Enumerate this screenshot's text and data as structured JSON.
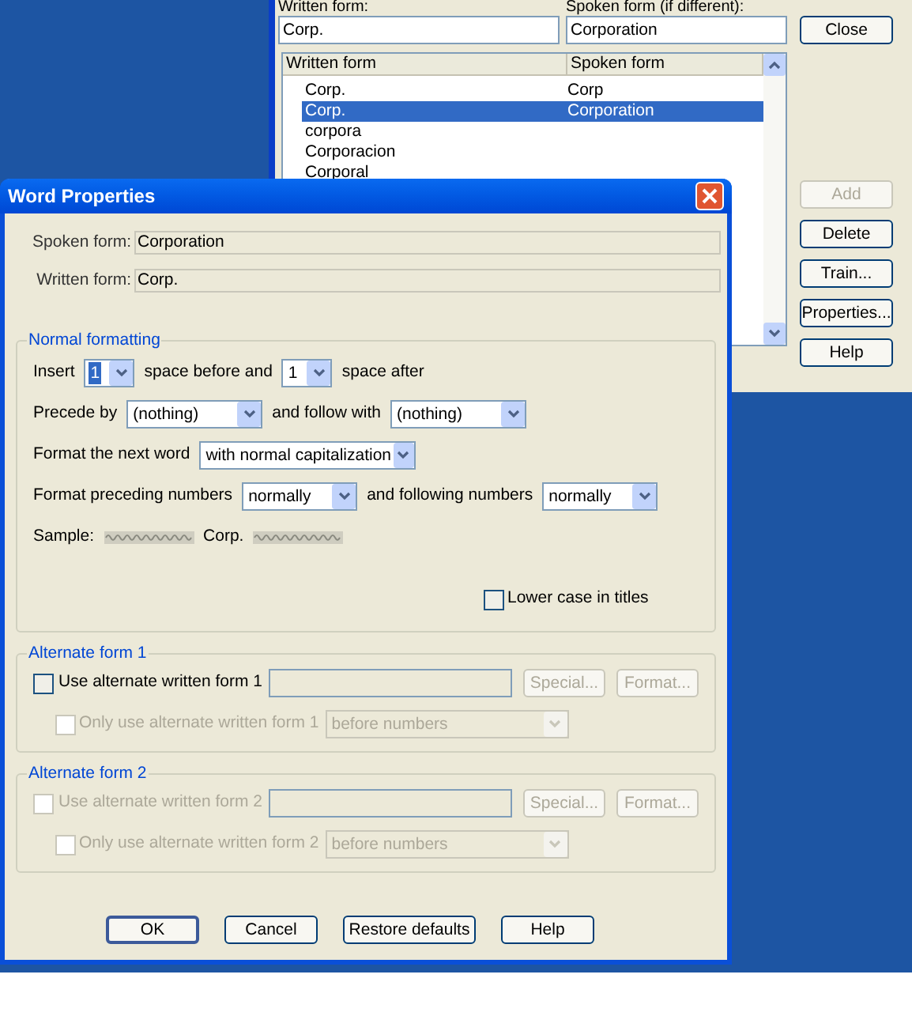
{
  "back_window": {
    "written_label": "Written form:",
    "spoken_label": "Spoken form (if different):",
    "written_value": "Corp.",
    "spoken_value": "Corporation",
    "list": {
      "columns": [
        "Written form",
        "Spoken form"
      ],
      "rows": [
        {
          "written": "Corp.",
          "spoken": "Corp",
          "selected": false
        },
        {
          "written": "Corp.",
          "spoken": "Corporation",
          "selected": true
        },
        {
          "written": "corpora",
          "selected": false
        },
        {
          "written": "Corporacion",
          "selected": false
        },
        {
          "written": "Corporal",
          "selected": false
        }
      ]
    },
    "close_button": "Close",
    "buttons": [
      {
        "label": "Add",
        "disabled": true
      },
      {
        "label": "Delete",
        "disabled": false
      },
      {
        "label": "Train...",
        "disabled": false
      },
      {
        "label": "Properties...",
        "disabled": false
      },
      {
        "label": "Help",
        "disabled": false
      }
    ]
  },
  "dialog": {
    "title": "Word Properties",
    "fields": [
      {
        "label": "Spoken form:",
        "value": "Corporation"
      },
      {
        "label": "Written form:",
        "value": "Corp."
      }
    ],
    "normal_formatting": {
      "title": "Normal formatting",
      "rows": [
        {
          "parts": [
            {
              "kind": "label",
              "text": "Insert"
            },
            {
              "kind": "dropdown",
              "value": "1",
              "highlighted": true
            },
            {
              "kind": "label",
              "text": "space before and"
            },
            {
              "kind": "dropdown",
              "value": "1",
              "highlighted": false
            },
            {
              "kind": "label",
              "text": "space after"
            }
          ]
        },
        {
          "parts": [
            {
              "kind": "label",
              "text": "Precede by"
            },
            {
              "kind": "dropdown",
              "value": "(nothing)",
              "highlighted": false
            },
            {
              "kind": "label",
              "text": "and follow with"
            },
            {
              "kind": "dropdown",
              "value": "(nothing)",
              "highlighted": false
            }
          ]
        },
        {
          "parts": [
            {
              "kind": "label",
              "text": "Format the next word"
            },
            {
              "kind": "dropdown",
              "value": "with normal capitalization",
              "highlighted": false
            }
          ]
        },
        {
          "parts": [
            {
              "kind": "label",
              "text": "Format preceding numbers"
            },
            {
              "kind": "dropdown",
              "value": "normally",
              "highlighted": false
            },
            {
              "kind": "label",
              "text": "and following numbers"
            },
            {
              "kind": "dropdown",
              "value": "normally",
              "highlighted": false
            }
          ]
        },
        {
          "parts": [
            {
              "kind": "label",
              "text": "Sample:"
            },
            {
              "kind": "squiggle"
            },
            {
              "kind": "label",
              "text": "Corp."
            },
            {
              "kind": "squiggle"
            }
          ]
        }
      ],
      "lower_case": {
        "label": "Lower case in titles",
        "checked": false
      }
    },
    "alternates": [
      {
        "title": "Alternate form 1",
        "use": {
          "label": "Use alternate written form 1",
          "checked": false,
          "disabled": false
        },
        "buttons": [
          {
            "label": "Special...",
            "disabled": true
          },
          {
            "label": "Format...",
            "disabled": true
          }
        ],
        "only": {
          "label": "Only use alternate written form 1",
          "checked": false,
          "disabled": true,
          "dropdown": "before numbers"
        }
      },
      {
        "title": "Alternate form 2",
        "use": {
          "label": "Use alternate written form 2",
          "checked": false,
          "disabled": true
        },
        "buttons": [
          {
            "label": "Special...",
            "disabled": true
          },
          {
            "label": "Format...",
            "disabled": true
          }
        ],
        "only": {
          "label": "Only use alternate written form 2",
          "checked": false,
          "disabled": true,
          "dropdown": "before numbers"
        }
      }
    ],
    "footer": [
      {
        "label": "OK",
        "default": true
      },
      {
        "label": "Cancel",
        "default": false
      },
      {
        "label": "Restore defaults",
        "default": false
      },
      {
        "label": "Help",
        "default": false
      }
    ]
  }
}
